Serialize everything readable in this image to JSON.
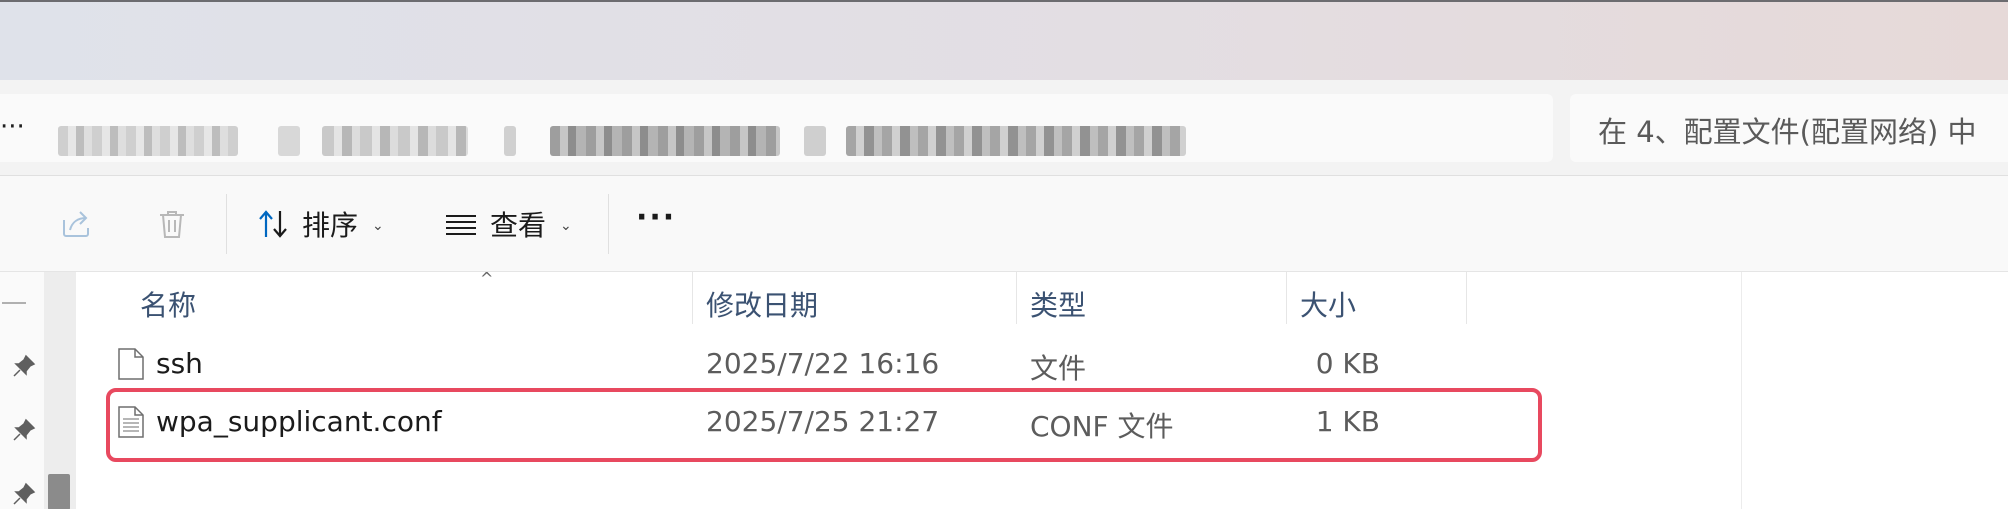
{
  "address": {
    "overflow": "···",
    "search_placeholder": "在 4、配置文件(配置网络) 中"
  },
  "toolbar": {
    "share_icon": "share-icon",
    "delete_icon": "trash-icon",
    "sort_label": "排序",
    "view_label": "查看",
    "more_label": "···"
  },
  "columns": {
    "name": "名称",
    "date": "修改日期",
    "type": "类型",
    "size": "大小"
  },
  "files": [
    {
      "name": "ssh",
      "date": "2025/7/22 16:16",
      "type": "文件",
      "size": "0 KB"
    },
    {
      "name": "wpa_supplicant.conf",
      "date": "2025/7/25 21:27",
      "type": "CONF 文件",
      "size": "1 KB"
    }
  ],
  "colors": {
    "highlight": "#e8495f",
    "header_text": "#3b5272",
    "accent": "#0067c0"
  }
}
